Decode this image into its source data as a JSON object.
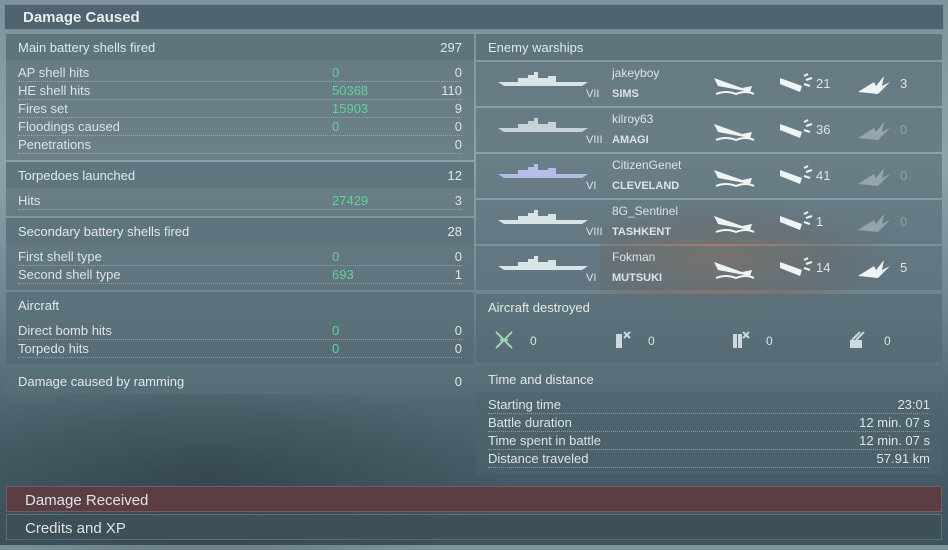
{
  "header": {
    "title": "Damage Caused"
  },
  "main_battery": {
    "label": "Main battery shells fired",
    "value": "297",
    "rows": [
      {
        "label": "AP shell hits",
        "dmg": "0",
        "val": "0"
      },
      {
        "label": "HE shell hits",
        "dmg": "50368",
        "val": "110"
      },
      {
        "label": "Fires set",
        "dmg": "15903",
        "val": "9"
      },
      {
        "label": "Floodings caused",
        "dmg": "0",
        "val": "0"
      },
      {
        "label": "Penetrations",
        "dmg": "",
        "val": "0"
      }
    ]
  },
  "torpedoes": {
    "label": "Torpedoes launched",
    "value": "12",
    "rows": [
      {
        "label": "Hits",
        "dmg": "27429",
        "val": "3"
      }
    ]
  },
  "secondary": {
    "label": "Secondary battery shells fired",
    "value": "28",
    "rows": [
      {
        "label": "First shell type",
        "dmg": "0",
        "val": "0"
      },
      {
        "label": "Second shell type",
        "dmg": "693",
        "val": "1"
      }
    ]
  },
  "aircraft": {
    "label": "Aircraft",
    "rows": [
      {
        "label": "Direct bomb hits",
        "dmg": "0",
        "val": "0"
      },
      {
        "label": "Torpedo hits",
        "dmg": "0",
        "val": "0"
      }
    ]
  },
  "ramming": {
    "label": "Damage caused by ramming",
    "value": "0"
  },
  "enemy": {
    "label": "Enemy warships",
    "ships": [
      {
        "player": "jakeyboy",
        "ship": "SIMS",
        "tier": "VII",
        "hits": "21",
        "kills": "3",
        "sil_color": "#d8e4e6",
        "kill_dim": false
      },
      {
        "player": "kilroy63",
        "ship": "AMAGI",
        "tier": "VIII",
        "hits": "36",
        "kills": "0",
        "sil_color": "#c6d2d6",
        "kill_dim": true
      },
      {
        "player": "CitizenGenet",
        "ship": "CLEVELAND",
        "tier": "VI",
        "hits": "41",
        "kills": "0",
        "sil_color": "#b8bde8",
        "kill_dim": true
      },
      {
        "player": "8G_Sentinel",
        "ship": "TASHKENT",
        "tier": "VIII",
        "hits": "1",
        "kills": "0",
        "sil_color": "#d8e4e6",
        "kill_dim": true
      },
      {
        "player": "Fokman",
        "ship": "MUTSUKI",
        "tier": "VI",
        "hits": "14",
        "kills": "5",
        "sil_color": "#d8e4e6",
        "kill_dim": false
      }
    ]
  },
  "aircraft_destroyed": {
    "label": "Aircraft destroyed",
    "counts": [
      "0",
      "0",
      "0",
      "0"
    ],
    "icons": [
      "fighter-icon",
      "torpedo-bomber-icon",
      "dive-bomber-icon",
      "aa-gun-icon"
    ]
  },
  "time": {
    "label": "Time and distance",
    "rows": [
      {
        "label": "Starting time",
        "value": "23:01"
      },
      {
        "label": "Battle duration",
        "value": "12 min. 07 s"
      },
      {
        "label": "Time spent in battle",
        "value": "12 min. 07 s"
      },
      {
        "label": "Distance traveled",
        "value": "57.91 km"
      }
    ]
  },
  "bottom": {
    "damage_received": "Damage Received",
    "credits": "Credits and XP"
  },
  "colors": {
    "damage_green": "#5fd39a",
    "received_bar": "#5a3e44",
    "credits_bar": "#3c5056"
  }
}
